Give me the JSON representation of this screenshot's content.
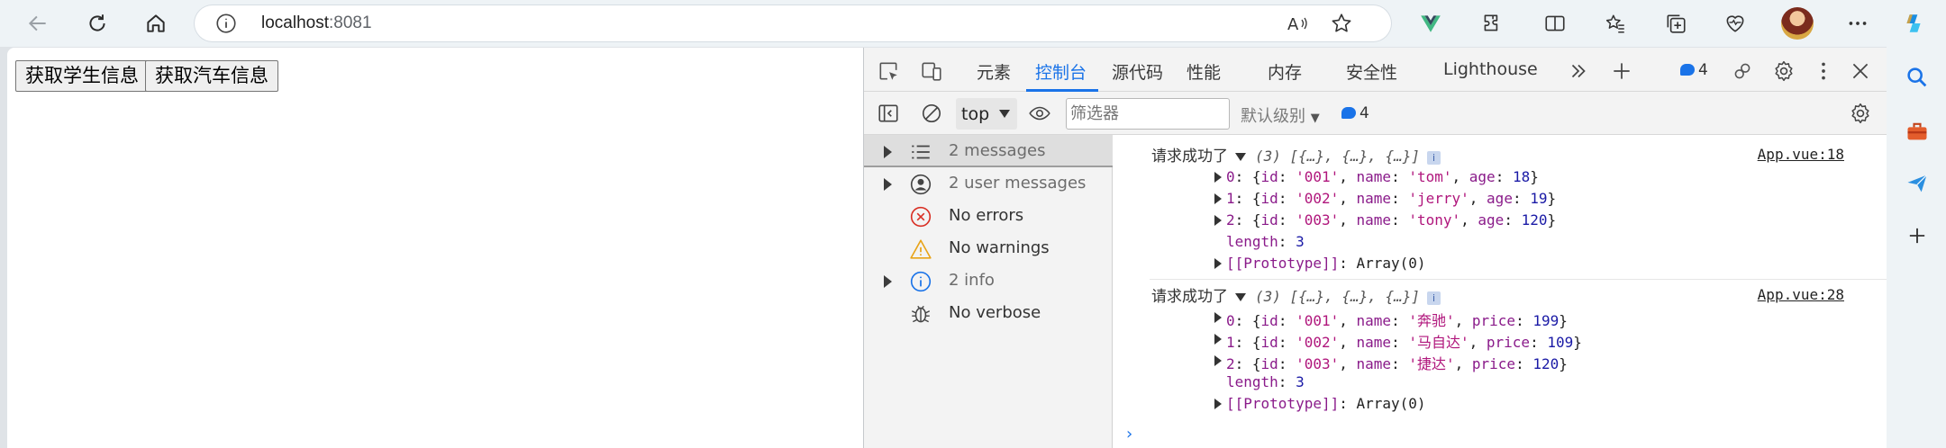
{
  "browser": {
    "url_host": "localhost",
    "url_port": ":8081",
    "profile": "avatar"
  },
  "page": {
    "buttons": [
      "获取学生信息",
      "获取汽车信息"
    ]
  },
  "devtools": {
    "tabs": [
      "元素",
      "控制台",
      "源代码",
      "性能",
      "内存",
      "安全性",
      "Lighthouse"
    ],
    "active_tab": "控制台",
    "issues_count": "4",
    "context": "top",
    "filter_placeholder": "筛选器",
    "level": "默认级别",
    "message_count": "4"
  },
  "console_sidebar": [
    {
      "label": "2 messages",
      "icon": "list-icon",
      "expandable": true,
      "selected": true
    },
    {
      "label": "2 user messages",
      "icon": "user-circle-icon",
      "expandable": true,
      "selected": false
    },
    {
      "label": "No errors",
      "icon": "error-icon",
      "expandable": false,
      "selected": false
    },
    {
      "label": "No warnings",
      "icon": "warning-icon",
      "expandable": false,
      "selected": false
    },
    {
      "label": "2 info",
      "icon": "info-icon",
      "expandable": true,
      "selected": false
    },
    {
      "label": "No verbose",
      "icon": "bug-icon",
      "expandable": false,
      "selected": false
    }
  ],
  "console_logs": [
    {
      "prefix": "请求成功了",
      "summary": "(3) [{…}, {…}, {…}]",
      "source": "App.vue:18",
      "items": [
        {
          "index": "0",
          "id": "001",
          "key2": "name",
          "val2": "tom",
          "key3": "age",
          "val3": "18"
        },
        {
          "index": "1",
          "id": "002",
          "key2": "name",
          "val2": "jerry",
          "key3": "age",
          "val3": "19"
        },
        {
          "index": "2",
          "id": "003",
          "key2": "name",
          "val2": "tony",
          "key3": "age",
          "val3": "120"
        }
      ],
      "length": "3",
      "prototype": "Array(0)"
    },
    {
      "prefix": "请求成功了",
      "summary": "(3) [{…}, {…}, {…}]",
      "source": "App.vue:28",
      "items": [
        {
          "index": "0",
          "id": "001",
          "key2": "name",
          "val2": "奔驰",
          "key3": "price",
          "val3": "199"
        },
        {
          "index": "1",
          "id": "002",
          "key2": "name",
          "val2": "马自达",
          "key3": "price",
          "val3": "109"
        },
        {
          "index": "2",
          "id": "003",
          "key2": "name",
          "val2": "捷达",
          "key3": "price",
          "val3": "120"
        }
      ],
      "length": "3",
      "prototype": "Array(0)"
    }
  ],
  "colors": {
    "accent": "#1a73e8",
    "string": "#b0167c",
    "key": "#8a1b8a",
    "number": "#1a1aa6"
  }
}
